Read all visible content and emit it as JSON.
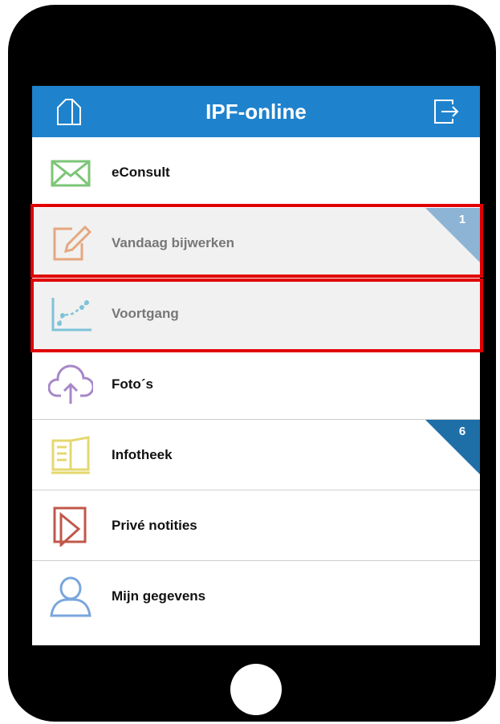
{
  "header": {
    "title": "IPF-online",
    "home_icon": "home-icon",
    "logout_icon": "logout-icon",
    "color": "#1f82cd"
  },
  "menu": {
    "items": [
      {
        "label": "eConsult",
        "icon": "envelope-icon",
        "icon_color": "#7cc576"
      },
      {
        "label": "Vandaag bijwerken",
        "icon": "edit-icon",
        "icon_color": "#e6a77f",
        "badge": "1",
        "badge_color": "#8db4d4"
      },
      {
        "label": "Voortgang",
        "icon": "progress-chart-icon",
        "icon_color": "#7ec3d8"
      },
      {
        "label": "Foto´s",
        "icon": "cloud-upload-icon",
        "icon_color": "#a787c9"
      },
      {
        "label": "Infotheek",
        "icon": "book-icon",
        "icon_color": "#e4d86f",
        "badge": "6",
        "badge_color": "#1e6fa8"
      },
      {
        "label": "Privé notities",
        "icon": "notes-icon",
        "icon_color": "#c0584a"
      },
      {
        "label": "Mijn gegevens",
        "icon": "user-icon",
        "icon_color": "#7aa6dc"
      }
    ]
  },
  "highlight_color": "#e10000"
}
